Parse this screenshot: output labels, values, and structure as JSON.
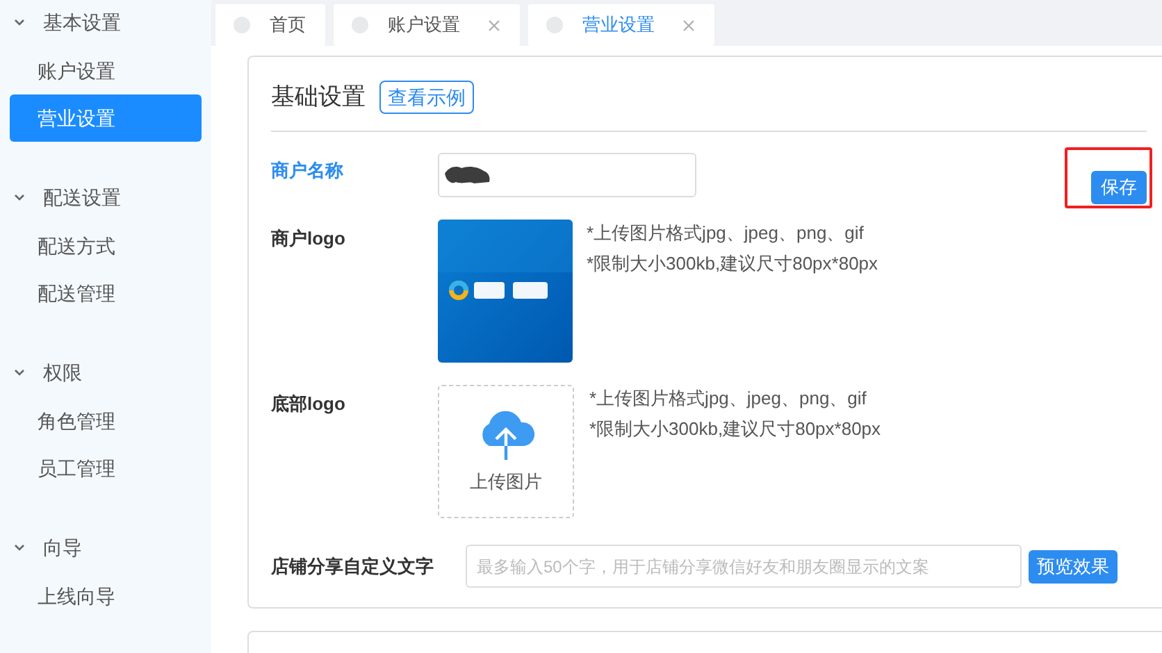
{
  "sidebar": {
    "groups": [
      {
        "label": "基本设置",
        "expanded": true,
        "items": [
          {
            "label": "账户设置",
            "selected": false
          },
          {
            "label": "营业设置",
            "selected": true
          }
        ]
      },
      {
        "label": "配送设置",
        "expanded": true,
        "items": [
          {
            "label": "配送方式",
            "selected": false
          },
          {
            "label": "配送管理",
            "selected": false
          }
        ]
      },
      {
        "label": "权限",
        "expanded": true,
        "items": [
          {
            "label": "角色管理",
            "selected": false
          },
          {
            "label": "员工管理",
            "selected": false
          }
        ]
      },
      {
        "label": "向导",
        "expanded": true,
        "items": [
          {
            "label": "上线向导",
            "selected": false
          }
        ]
      }
    ]
  },
  "tabs": [
    {
      "label": "首页",
      "selected": false,
      "closable": false
    },
    {
      "label": "账户设置",
      "selected": false,
      "closable": true
    },
    {
      "label": "营业设置",
      "selected": true,
      "closable": true
    }
  ],
  "card": {
    "title": "基础设置",
    "example_button": "查看示例",
    "merchant_name": {
      "label": "商户名称",
      "redacted": true
    },
    "save_button": {
      "label": "保存",
      "highlighted": true
    },
    "merchant_logo": {
      "label": "商户logo",
      "image": {
        "kind": "picture"
      },
      "hints": [
        "*上传图片格式jpg、jpeg、png、gif",
        "*限制大小300kb,建议尺寸80px*80px"
      ]
    },
    "footer_logo": {
      "label": "底部logo",
      "upload_label": "上传图片",
      "hints": [
        "*上传图片格式jpg、jpeg、png、gif",
        "*限制大小300kb,建议尺寸80px*80px"
      ]
    },
    "share_text": {
      "label": "店铺分享自定义文字",
      "placeholder": "最多输入50个字，用于店铺分享微信好友和朋友圈显示的文案",
      "button": "预览效果"
    }
  }
}
